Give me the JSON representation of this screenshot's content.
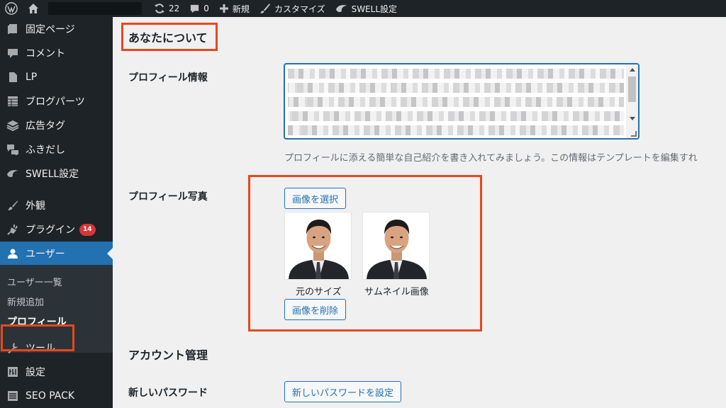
{
  "adminbar": {
    "updates_count": "22",
    "comments_count": "0",
    "new_label": "新規",
    "customize_label": "カスタマイズ",
    "swell_label": "SWELL設定"
  },
  "sidebar": {
    "items": [
      {
        "label": "固定ページ",
        "icon": "page-icon"
      },
      {
        "label": "コメント",
        "icon": "comment-icon"
      },
      {
        "label": "LP",
        "icon": "document-icon"
      },
      {
        "label": "ブログパーツ",
        "icon": "table-icon"
      },
      {
        "label": "広告タグ",
        "icon": "stack-icon"
      },
      {
        "label": "ふきだし",
        "icon": "bubble-icon"
      },
      {
        "label": "SWELL設定",
        "icon": "swell-icon"
      },
      {
        "label": "外観",
        "icon": "brush-icon"
      },
      {
        "label": "プラグイン",
        "icon": "plugin-icon",
        "badge": "14"
      },
      {
        "label": "ユーザー",
        "icon": "user-icon"
      },
      {
        "label": "ツール",
        "icon": "wrench-icon"
      },
      {
        "label": "設定",
        "icon": "settings-icon"
      },
      {
        "label": "SEO PACK",
        "icon": "seo-icon"
      }
    ],
    "submenu": [
      "ユーザー一覧",
      "新規追加",
      "プロフィール"
    ]
  },
  "colors": {
    "accent": "#2271b1",
    "highlight": "#e8471d",
    "sidebar_bg": "#1d2327",
    "badge": "#d63638"
  },
  "main": {
    "section_about": "あなたについて",
    "bio_label": "プロフィール情報",
    "bio_description": "プロフィールに添える簡単な自己紹介を書き入れてみましょう。この情報はテンプレートを編集すれ",
    "photo_label": "プロフィール写真",
    "select_image_button": "画像を選択",
    "original_size_caption": "元のサイズ",
    "thumbnail_caption": "サムネイル画像",
    "delete_image_button": "画像を削除",
    "section_account": "アカウント管理",
    "new_password_label": "新しいパスワード",
    "set_password_button": "新しいパスワードを設定"
  }
}
